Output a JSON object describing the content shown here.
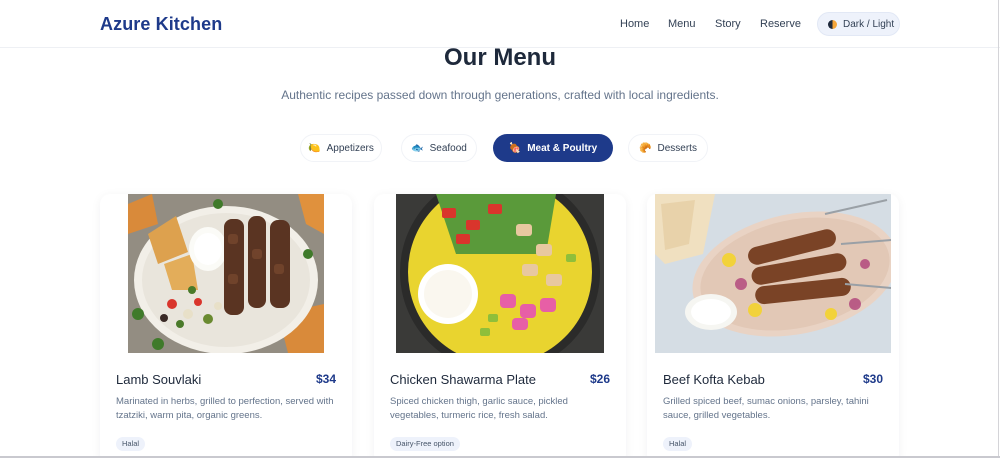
{
  "header": {
    "brand": "Azure Kitchen",
    "nav": [
      "Home",
      "Menu",
      "Story",
      "Reserve"
    ],
    "theme_toggle": "Dark / Light"
  },
  "intro": {
    "title": "Our Menu",
    "subtitle": "Authentic recipes passed down through generations, crafted with local ingredients."
  },
  "tabs": [
    {
      "label": "Appetizers",
      "icon": "lemon-icon",
      "glyph": "🍋",
      "active": false
    },
    {
      "label": "Seafood",
      "icon": "fish-icon",
      "glyph": "🐟",
      "active": false
    },
    {
      "label": "Meat & Poultry",
      "icon": "meat-icon",
      "glyph": "🍖",
      "active": true
    },
    {
      "label": "Desserts",
      "icon": "dessert-icon",
      "glyph": "🥐",
      "active": false
    }
  ],
  "dishes": [
    {
      "name": "Lamb Souvlaki",
      "price": "$34",
      "description": "Marinated in herbs, grilled to perfection, served with tzatziki, warm pita, organic greens.",
      "tag": "Halal"
    },
    {
      "name": "Chicken Shawarma Plate",
      "price": "$26",
      "description": "Spiced chicken thigh, garlic sauce, pickled vegetables, turmeric rice, fresh salad.",
      "tag": "Dairy-Free option"
    },
    {
      "name": "Beef Kofta Kebab",
      "price": "$30",
      "description": "Grilled spiced beef, sumac onions, parsley, tahini sauce, grilled vegetables.",
      "tag": "Halal"
    }
  ],
  "colors": {
    "brand": "#1e3a8a",
    "active_tab": "#1e3a8a",
    "price": "#1e3a8a",
    "muted_text": "#64748b"
  }
}
